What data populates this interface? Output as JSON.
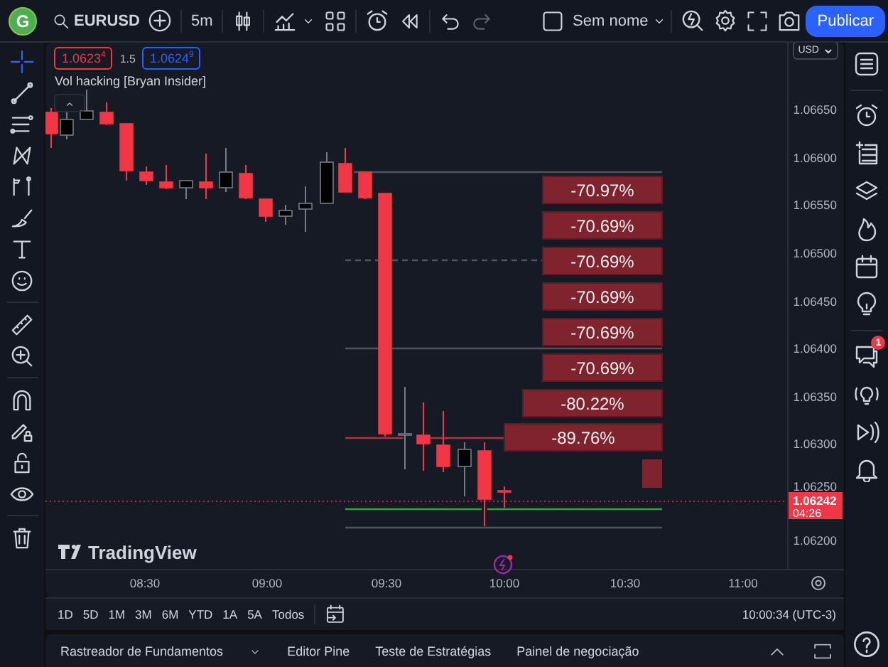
{
  "top_bar": {
    "avatar": "G",
    "symbol": "EURUSD",
    "interval": "5m",
    "layout_name": "Sem nome",
    "publish_button": "Publicar"
  },
  "quote": {
    "sell": "1.0623$^{4}$",
    "spread": "1.5",
    "buy": "1.0624$^{9}$"
  },
  "indicator_label": "Vol hacking [Bryan Insider]",
  "currency": "USD",
  "price_axis": [
    "1.06650",
    "1.06600",
    "1.06550",
    "1.06500",
    "1.06450",
    "1.06400",
    "1.06350",
    "1.06300",
    "1.06250",
    "1.06200"
  ],
  "current_price": {
    "price": "1.06242",
    "countdown": "04:26"
  },
  "percent_labels": [
    "-70.97%",
    "-70.69%",
    "-70.69%",
    "-70.69%",
    "-70.69%",
    "-70.69%",
    "-80.22%",
    "-89.76%"
  ],
  "logo": "TradingView",
  "time_axis": [
    "08:30",
    "09:00",
    "09:30",
    "10:00",
    "10:30",
    "11:00"
  ],
  "ranges": [
    "1D",
    "5D",
    "1M",
    "3M",
    "6M",
    "YTD",
    "1A",
    "5A",
    "Todos"
  ],
  "clock": "10:00:34 (UTC-3)",
  "bottom_tabs": [
    "Rastreador de Fundamentos",
    "Editor Pine",
    "Teste de Estratégias",
    "Painel de negociação"
  ],
  "notification_badge": "1"
}
